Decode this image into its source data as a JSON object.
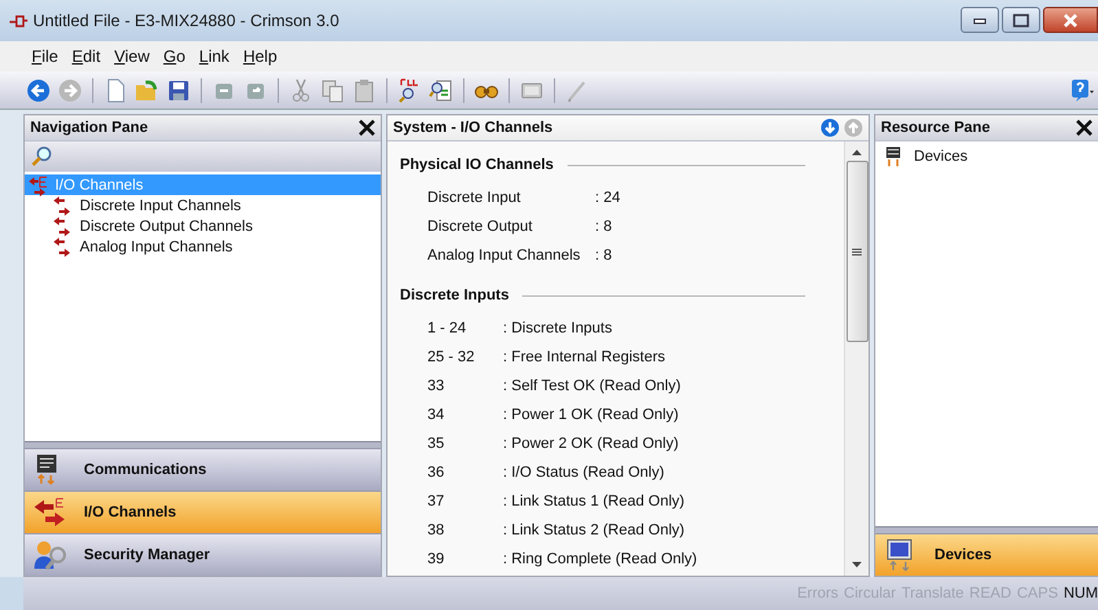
{
  "window": {
    "title": "Untitled File - E3-MIX24880 - Crimson 3.0"
  },
  "menu": [
    {
      "label": "File"
    },
    {
      "label": "Edit"
    },
    {
      "label": "View"
    },
    {
      "label": "Go"
    },
    {
      "label": "Link"
    },
    {
      "label": "Help"
    }
  ],
  "navigation_pane": {
    "title": "Navigation Pane",
    "tree": [
      {
        "label": "I/O Channels",
        "selected": true,
        "children": [
          {
            "label": "Discrete Input Channels",
            "selected": false
          },
          {
            "label": "Discrete Output Channels",
            "selected": false
          },
          {
            "label": "Analog Input Channels",
            "selected": false
          }
        ]
      }
    ],
    "buttons": [
      {
        "label": "Communications",
        "kind": "communications",
        "selected": false
      },
      {
        "label": "I/O Channels",
        "kind": "io",
        "selected": true
      },
      {
        "label": "Security Manager",
        "kind": "security",
        "selected": false
      }
    ]
  },
  "editor": {
    "title": "System - I/O Channels",
    "sections": [
      {
        "heading": "Physical IO Channels",
        "kind": "wide",
        "rows": [
          {
            "key": "Discrete Input",
            "value": ":  24"
          },
          {
            "key": "Discrete Output",
            "value": ":  8"
          },
          {
            "key": "Analog Input Channels",
            "value": ":  8"
          }
        ]
      },
      {
        "heading": "Discrete Inputs",
        "kind": "narrow",
        "rows": [
          {
            "key": "1 - 24",
            "value": ":  Discrete Inputs"
          },
          {
            "key": "25 - 32",
            "value": ":  Free Internal Registers"
          },
          {
            "key": "33",
            "value": ":  Self Test OK (Read Only)"
          },
          {
            "key": "34",
            "value": ":  Power 1 OK (Read Only)"
          },
          {
            "key": "35",
            "value": ":  Power 2 OK (Read Only)"
          },
          {
            "key": "36",
            "value": ":  I/O Status (Read Only)"
          },
          {
            "key": "37",
            "value": ":  Link Status 1 (Read Only)"
          },
          {
            "key": "38",
            "value": ":  Link Status 2 (Read Only)"
          },
          {
            "key": "39",
            "value": ":  Ring Complete (Read Only)"
          }
        ]
      }
    ]
  },
  "resource_pane": {
    "title": "Resource Pane",
    "items": [
      {
        "label": "Devices"
      }
    ],
    "buttons": [
      {
        "label": "Devices",
        "selected": true
      }
    ]
  },
  "status_bar": [
    {
      "label": "Errors",
      "on": false
    },
    {
      "label": "Circular",
      "on": false
    },
    {
      "label": "Translate",
      "on": false
    },
    {
      "label": "READ",
      "on": false
    },
    {
      "label": "CAPS",
      "on": false
    },
    {
      "label": "NUM",
      "on": true
    }
  ]
}
